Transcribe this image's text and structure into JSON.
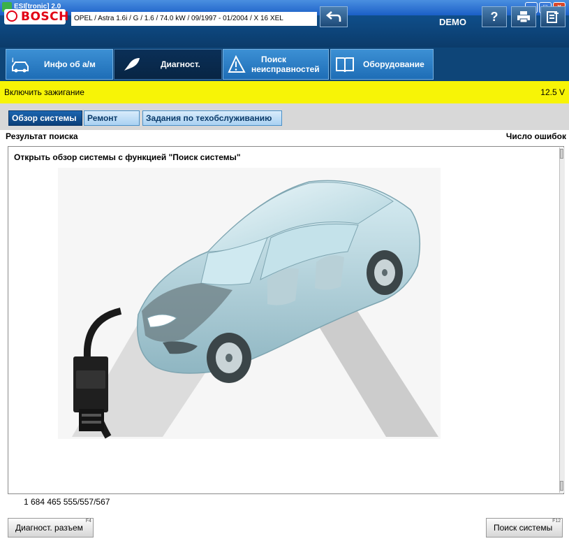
{
  "window": {
    "title": "ESI[tronic] 2.0",
    "min": "–",
    "max": "□",
    "close": "×"
  },
  "header": {
    "brand": "BOSCH",
    "vehicle": "OPEL / Astra 1.6i / G / 1.6 / 74.0 kW / 09/1997 - 01/2004 / X 16 XEL",
    "mode": "DEMO",
    "help_glyph": "?"
  },
  "nav": {
    "tabs": [
      {
        "label": "Инфо об а/м",
        "icon": "car-info-icon"
      },
      {
        "label": "Диагност.",
        "icon": "diagnosis-plug-icon",
        "active": true
      },
      {
        "label1": "Поиск",
        "label2": "неисправностей",
        "icon": "warning-car-icon"
      },
      {
        "label": "Оборудование",
        "icon": "book-icon"
      }
    ]
  },
  "status": {
    "message": "Включить зажигание",
    "voltage": "12.5 V"
  },
  "subtabs": [
    {
      "label": "Обзор системы",
      "active": true
    },
    {
      "label": "Ремонт"
    },
    {
      "label": "Задания по техобслуживанию"
    }
  ],
  "results": {
    "left_header": "Результат поиска",
    "right_header": "Число ошибок",
    "caption": "Открыть обзор системы с функцией \"Поиск системы\"",
    "image_icon": "car-obd-connector-illustration"
  },
  "footer": {
    "part_number": "1 684 465 555/557/567",
    "left_button": {
      "label": "Диагност. разъем",
      "key": "F4"
    },
    "right_button": {
      "label": "Поиск системы",
      "key": "F12"
    }
  },
  "colors": {
    "status_bar": "#f7f406",
    "header_bg": "#0e4578",
    "brand_red": "#e20015"
  }
}
